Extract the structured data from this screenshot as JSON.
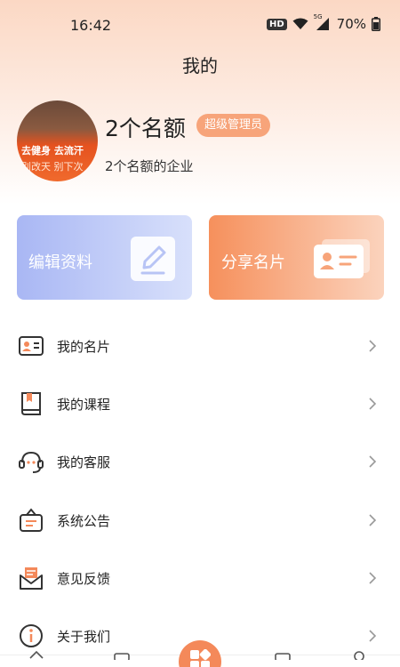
{
  "status_bar": {
    "time": "16:42",
    "hd": "HD",
    "signal": "5G",
    "battery": "70%"
  },
  "header": {
    "title": "我的"
  },
  "profile": {
    "name": "2个名额",
    "role_badge": "超级管理员",
    "subtitle": "2个名额的企业",
    "avatar_text_line1": "去健身 去流汗",
    "avatar_text_line2": "别改天 别下次"
  },
  "cards": {
    "edit_profile": "编辑资料",
    "share_card": "分享名片"
  },
  "menu": [
    {
      "label": "我的名片",
      "icon": "business-card-icon"
    },
    {
      "label": "我的课程",
      "icon": "book-icon"
    },
    {
      "label": "我的客服",
      "icon": "headset-icon"
    },
    {
      "label": "系统公告",
      "icon": "announcement-icon"
    },
    {
      "label": "意见反馈",
      "icon": "feedback-mail-icon"
    },
    {
      "label": "关于我们",
      "icon": "info-icon"
    }
  ],
  "colors": {
    "accent": "#f4895a",
    "badge": "#f7a47a",
    "edit_card": "#a9b7f4",
    "share_card": "#f6905c"
  }
}
